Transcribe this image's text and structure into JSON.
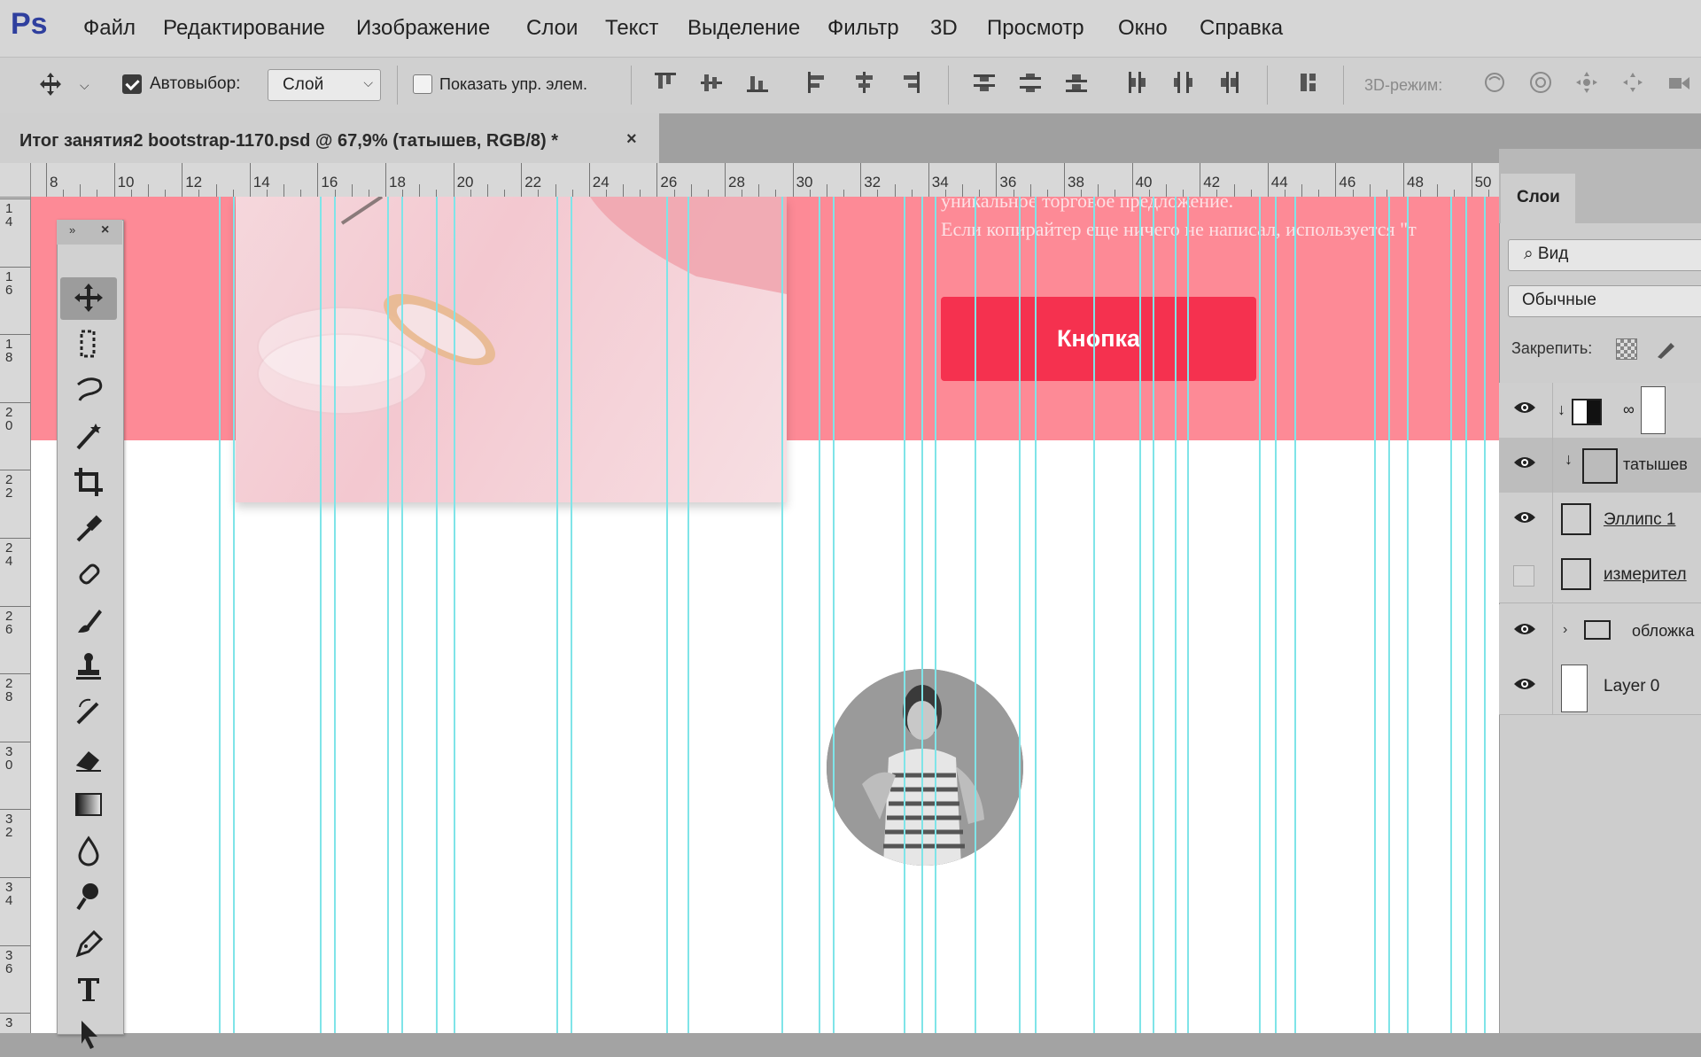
{
  "app": {
    "logo": "Ps",
    "menu": [
      "Файл",
      "Редактирование",
      "Изображение",
      "Слои",
      "Текст",
      "Выделение",
      "Фильтр",
      "3D",
      "Просмотр",
      "Окно",
      "Справка"
    ]
  },
  "options_bar": {
    "autoselect_label": "Автовыбор:",
    "autoselect_checked": true,
    "layer_select_value": "Слой",
    "show_controls_label": "Показать упр. элем.",
    "show_controls_checked": false,
    "mode_3d_label": "3D-режим:"
  },
  "document_tab": {
    "title": "Итог занятия2 bootstrap-1170.psd @ 67,9% (татышев, RGB/8) *",
    "close": "×"
  },
  "rulers": {
    "horizontal": [
      "8",
      "10",
      "12",
      "14",
      "16",
      "18",
      "20",
      "22",
      "24",
      "26",
      "28",
      "30",
      "32",
      "34",
      "36",
      "38",
      "40",
      "42",
      "44",
      "46",
      "48",
      "50"
    ],
    "vertical": [
      "14",
      "16",
      "18",
      "20",
      "22",
      "24",
      "26",
      "28",
      "30",
      "32",
      "34",
      "36",
      "3"
    ]
  },
  "canvas": {
    "hero_text_line1": "уникальное торговое предложение.",
    "hero_text_line2": "Если копирайтер еще ничего не написал, используется \"т",
    "hero_button_label": "Кнопка",
    "pink_color": "#fd8a96",
    "button_color": "#f5314f",
    "guide_color": "#7fe4e8"
  },
  "toolbox": {
    "tools": [
      "move-tool-icon",
      "marquee-tool-icon",
      "lasso-tool-icon",
      "magic-wand-icon",
      "crop-tool-icon",
      "eyedropper-icon",
      "healing-brush-icon",
      "brush-icon",
      "stamp-icon",
      "history-brush-icon",
      "eraser-icon",
      "gradient-icon",
      "blur-icon",
      "dodge-icon",
      "pen-icon",
      "type-icon",
      "path-select-icon"
    ]
  },
  "layers_panel": {
    "tab_label": "Слои",
    "filter_label": "Вид",
    "blend_mode": "Обычные",
    "lock_label": "Закрепить:",
    "layers": [
      {
        "name": "",
        "visible": true,
        "type": "adjustment"
      },
      {
        "name": "татышев",
        "visible": true,
        "type": "smart-object",
        "selected": true
      },
      {
        "name": "Эллипс 1",
        "visible": true,
        "type": "shape"
      },
      {
        "name": "измерител",
        "visible": false,
        "type": "shape"
      },
      {
        "name": "обложка",
        "visible": true,
        "type": "group"
      },
      {
        "name": "Layer 0",
        "visible": true,
        "type": "pixel"
      }
    ]
  }
}
